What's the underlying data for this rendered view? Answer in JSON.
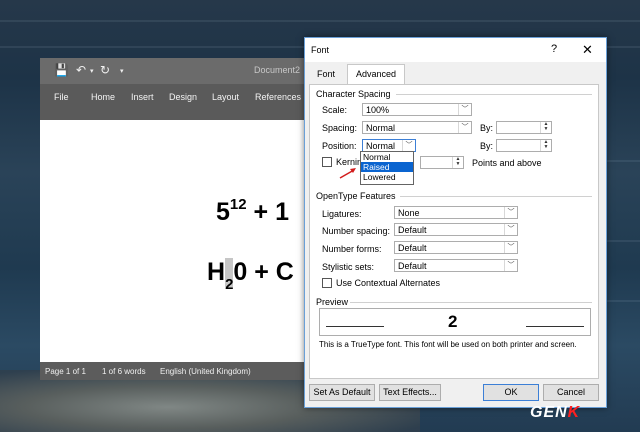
{
  "word": {
    "doc_name": "Document2",
    "ribbon_tabs": [
      "File",
      "Home",
      "Insert",
      "Design",
      "Layout",
      "References"
    ],
    "eq1": {
      "base": "5",
      "sup": "12",
      "rest": " + 1"
    },
    "eq2": {
      "h": "H",
      "sub": "2",
      "rest": "0 + C"
    },
    "status": {
      "page": "Page 1 of 1",
      "words": "1 of 6 words",
      "language": "English (United Kingdom)"
    }
  },
  "dialog": {
    "title": "Font",
    "help": "?",
    "close": "✕",
    "tabs": {
      "font": "Font",
      "advanced": "Advanced"
    },
    "character_spacing": {
      "heading": "Character Spacing",
      "scale_label": "Scale:",
      "scale_value": "100%",
      "spacing_label": "Spacing:",
      "spacing_value": "Normal",
      "spacing_by_label": "By:",
      "position_label": "Position:",
      "position_value": "Normal",
      "position_by_label": "By:",
      "kerning_label": "Kerning",
      "points_label": "Points and above",
      "position_options": [
        "Normal",
        "Raised",
        "Lowered"
      ],
      "highlighted_option": "Raised"
    },
    "opentype": {
      "heading": "OpenType Features",
      "ligatures_label": "Ligatures:",
      "ligatures_value": "None",
      "number_spacing_label": "Number spacing:",
      "number_spacing_value": "Default",
      "number_forms_label": "Number forms:",
      "number_forms_value": "Default",
      "stylistic_sets_label": "Stylistic sets:",
      "stylistic_sets_value": "Default",
      "contextual_label": "Use Contextual Alternates"
    },
    "preview": {
      "heading": "Preview",
      "sample": "2",
      "note": "This is a TrueType font. This font will be used on both printer and screen."
    },
    "buttons": {
      "set_default": "Set As Default",
      "text_effects": "Text Effects...",
      "ok": "OK",
      "cancel": "Cancel"
    }
  },
  "watermark": {
    "text": "GEN",
    "accent": "K"
  },
  "colors": {
    "accent": "#0a64d0",
    "arrow": "#d21c1c",
    "word_chrome": "#5a5a5a"
  }
}
